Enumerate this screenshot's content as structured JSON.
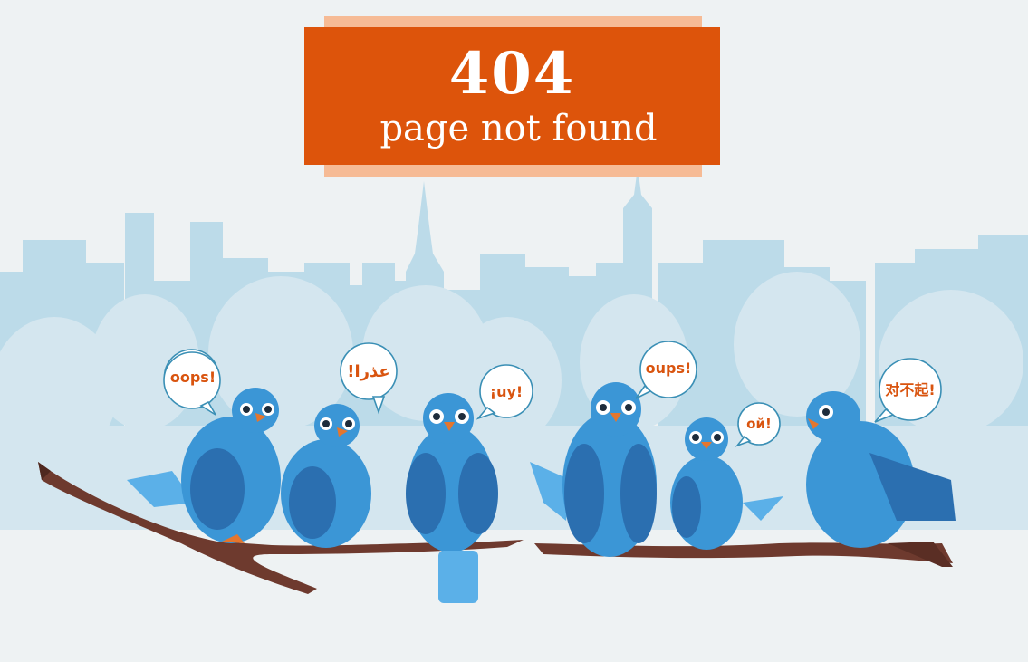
{
  "error": {
    "code": "404",
    "message": "page not found"
  },
  "speech_bubbles": [
    {
      "text": "oops!"
    },
    {
      "text": "!عذرا"
    },
    {
      "text": "¡uy!"
    },
    {
      "text": "oups!"
    },
    {
      "text": "ой!"
    },
    {
      "text": "对不起!"
    }
  ],
  "colors": {
    "banner": "#dd540b",
    "banner_shadow": "#f6bb95",
    "skyline": "#bcdbe9",
    "bird": "#3b96d6",
    "branch": "#6e3a2e",
    "bubble_text": "#d9540f"
  }
}
